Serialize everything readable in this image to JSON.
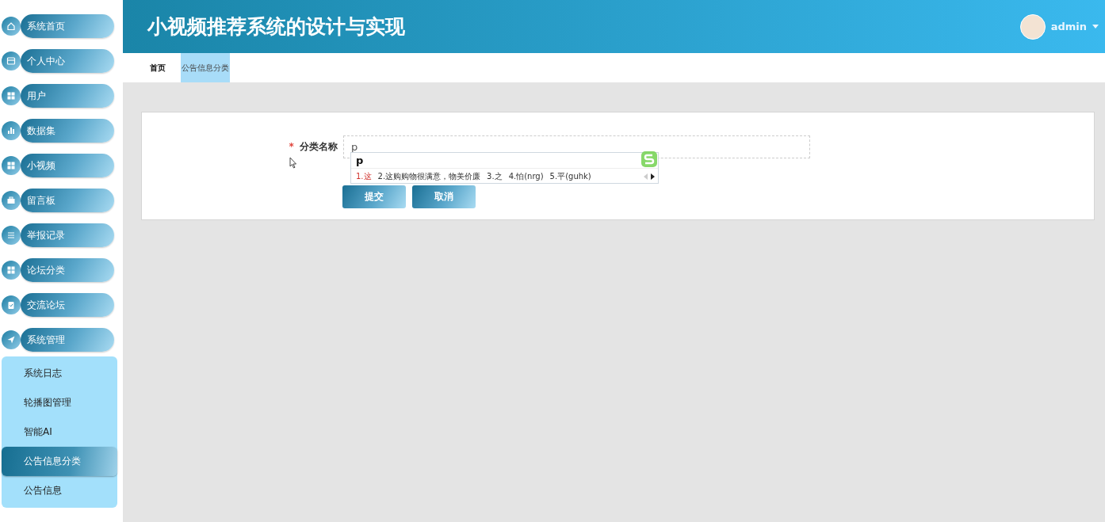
{
  "header": {
    "title": "小视频推荐系统的设计与实现",
    "user": "admin"
  },
  "sidebar": {
    "items": [
      {
        "label": "系统首页"
      },
      {
        "label": "个人中心"
      },
      {
        "label": "用户"
      },
      {
        "label": "数据集"
      },
      {
        "label": "小视频"
      },
      {
        "label": "留言板"
      },
      {
        "label": "举报记录"
      },
      {
        "label": "论坛分类"
      },
      {
        "label": "交流论坛"
      },
      {
        "label": "系统管理",
        "children": [
          {
            "label": "系统日志",
            "selected": false
          },
          {
            "label": "轮播图管理",
            "selected": false
          },
          {
            "label": "智能AI",
            "selected": false
          },
          {
            "label": "公告信息分类",
            "selected": true
          },
          {
            "label": "公告信息",
            "selected": false
          }
        ]
      }
    ]
  },
  "breadcrumb_tabs": [
    {
      "label": "首页",
      "selected": false
    },
    {
      "label": "公告信息分类",
      "selected": true
    }
  ],
  "form": {
    "field": {
      "label": "分类名称",
      "required_mark": "*",
      "value": "p"
    },
    "buttons": [
      "提交",
      "取消"
    ]
  },
  "ime_popup": {
    "composition": "p",
    "candidates": [
      {
        "label": "1.这",
        "selected": true
      },
      {
        "label": "2.这购购物很满意，物美价廉",
        "selected": false
      },
      {
        "label": "3.之",
        "selected": false
      },
      {
        "label": "4.怕(nrg)",
        "selected": false
      },
      {
        "label": "5.平(guhk)",
        "selected": false
      }
    ]
  }
}
